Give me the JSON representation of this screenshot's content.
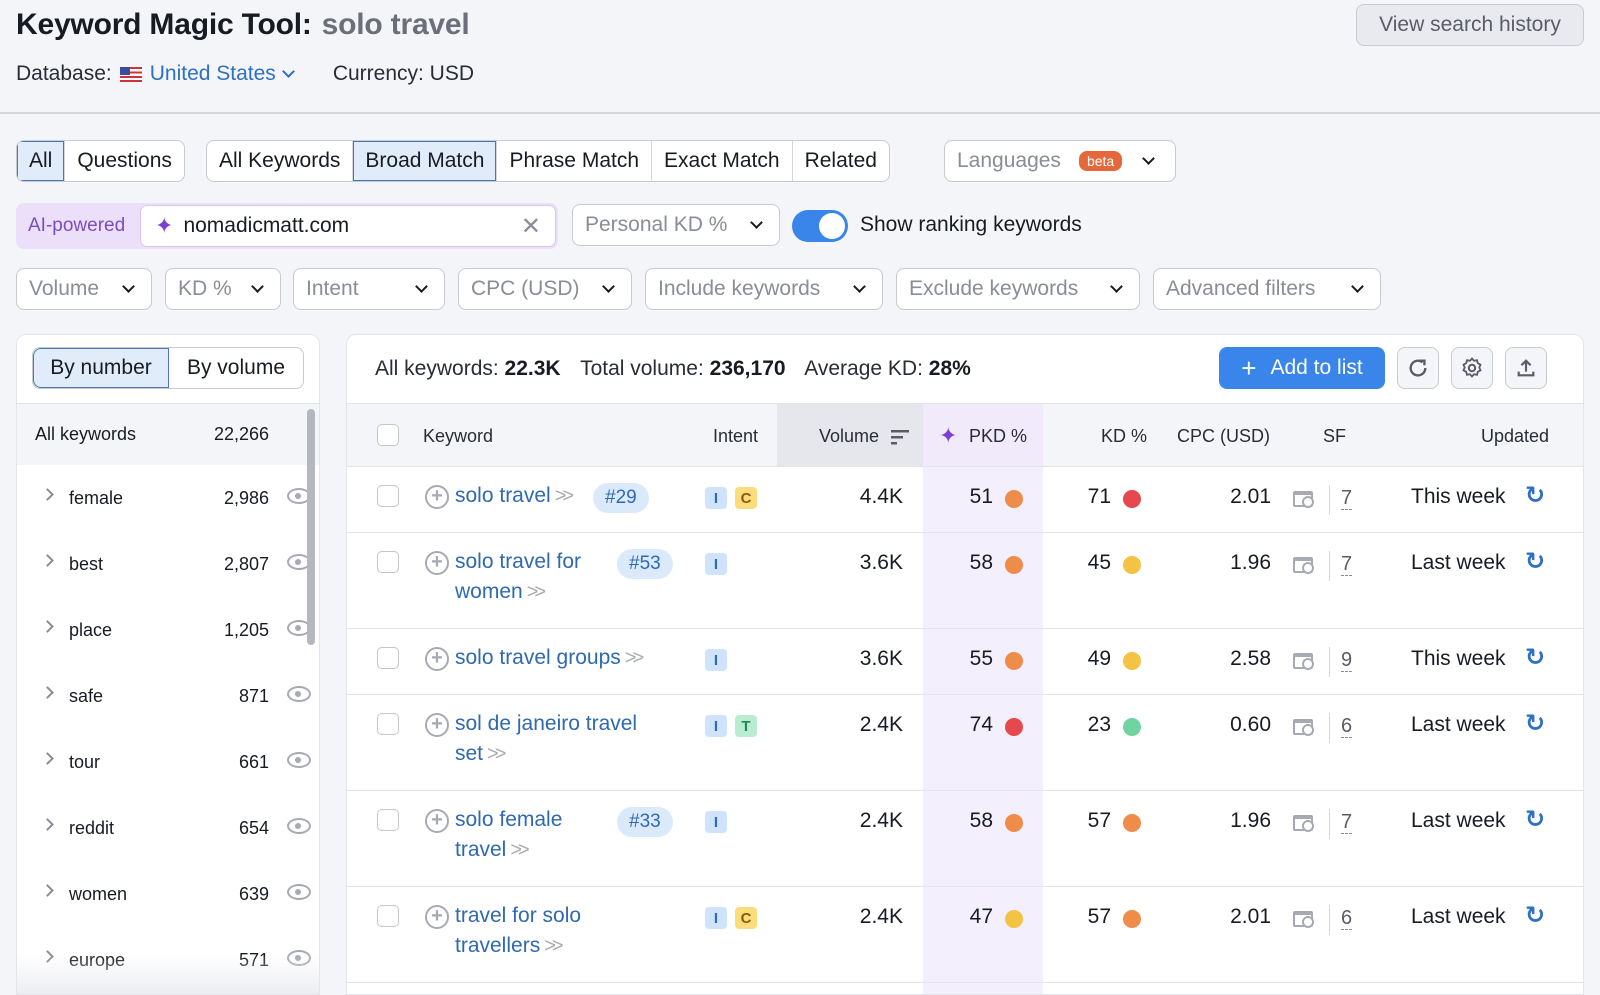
{
  "header": {
    "title": "Keyword Magic Tool:",
    "query": "solo travel",
    "database_label": "Database:",
    "database_value": "United States",
    "currency": "Currency: USD",
    "history_button": "View search history"
  },
  "tabs_type": [
    {
      "label": "All",
      "active": true
    },
    {
      "label": "Questions",
      "active": false
    }
  ],
  "tabs_match": [
    {
      "label": "All Keywords",
      "active": false
    },
    {
      "label": "Broad Match",
      "active": true
    },
    {
      "label": "Phrase Match",
      "active": false
    },
    {
      "label": "Exact Match",
      "active": false
    },
    {
      "label": "Related",
      "active": false
    }
  ],
  "languages": {
    "label": "Languages",
    "badge": "beta"
  },
  "ai": {
    "label": "AI-powered",
    "domain_value": "nomadicmatt.com",
    "personal_kd_placeholder": "Personal KD %",
    "toggle_label": "Show ranking keywords",
    "toggle_on": true
  },
  "filters": [
    "Volume",
    "KD %",
    "Intent",
    "CPC (USD)",
    "Include keywords",
    "Exclude keywords",
    "Advanced filters"
  ],
  "sidebar": {
    "tabs": [
      "By number",
      "By volume"
    ],
    "active_tab": "By number",
    "all_label": "All keywords",
    "all_count": "22,266",
    "groups": [
      {
        "name": "female",
        "count": "2,986"
      },
      {
        "name": "best",
        "count": "2,807"
      },
      {
        "name": "place",
        "count": "1,205"
      },
      {
        "name": "safe",
        "count": "871"
      },
      {
        "name": "tour",
        "count": "661"
      },
      {
        "name": "reddit",
        "count": "654"
      },
      {
        "name": "women",
        "count": "639"
      },
      {
        "name": "europe",
        "count": "571"
      }
    ]
  },
  "summary": {
    "all_label": "All keywords:",
    "all_value": "22.3K",
    "volume_label": "Total volume:",
    "volume_value": "236,170",
    "kd_label": "Average KD:",
    "kd_value": "28%",
    "add_button": "Add to list"
  },
  "table": {
    "columns": [
      "Keyword",
      "Intent",
      "Volume",
      "PKD %",
      "KD %",
      "CPC (USD)",
      "SF",
      "Updated"
    ],
    "rows": [
      {
        "keyword_l1": "solo travel",
        "keyword_l2": "",
        "rank": "#29",
        "intents": [
          "I",
          "C"
        ],
        "volume": "4.4K",
        "pkd": "51",
        "pkd_color": "#f08c4a",
        "kd": "71",
        "kd_color": "#e5484d",
        "cpc": "2.01",
        "sf": "7",
        "updated": "This week"
      },
      {
        "keyword_l1": "solo travel for",
        "keyword_l2": "women",
        "rank": "#53",
        "intents": [
          "I"
        ],
        "volume": "3.6K",
        "pkd": "58",
        "pkd_color": "#f08c4a",
        "kd": "45",
        "kd_color": "#f5c343",
        "cpc": "1.96",
        "sf": "7",
        "updated": "Last week"
      },
      {
        "keyword_l1": "solo travel groups",
        "keyword_l2": "",
        "rank": "",
        "intents": [
          "I"
        ],
        "volume": "3.6K",
        "pkd": "55",
        "pkd_color": "#f08c4a",
        "kd": "49",
        "kd_color": "#f5c343",
        "cpc": "2.58",
        "sf": "9",
        "updated": "This week"
      },
      {
        "keyword_l1": "sol de janeiro travel",
        "keyword_l2": "set",
        "rank": "",
        "intents": [
          "I",
          "T"
        ],
        "volume": "2.4K",
        "pkd": "74",
        "pkd_color": "#e5484d",
        "kd": "23",
        "kd_color": "#6fd4a0",
        "cpc": "0.60",
        "sf": "6",
        "updated": "Last week"
      },
      {
        "keyword_l1": "solo female",
        "keyword_l2": "travel",
        "rank": "#33",
        "intents": [
          "I"
        ],
        "volume": "2.4K",
        "pkd": "58",
        "pkd_color": "#f08c4a",
        "kd": "57",
        "kd_color": "#f08c4a",
        "cpc": "1.96",
        "sf": "7",
        "updated": "Last week"
      },
      {
        "keyword_l1": "travel for solo",
        "keyword_l2": "travellers",
        "rank": "",
        "intents": [
          "I",
          "C"
        ],
        "volume": "2.4K",
        "pkd": "47",
        "pkd_color": "#f5c343",
        "kd": "57",
        "kd_color": "#f08c4a",
        "cpc": "2.01",
        "sf": "6",
        "updated": "Last week"
      }
    ]
  },
  "colors": {
    "accent": "#3a85ea",
    "link": "#2f69b3",
    "ai_purple": "#7b3fd4",
    "beta": "#e4683a"
  }
}
